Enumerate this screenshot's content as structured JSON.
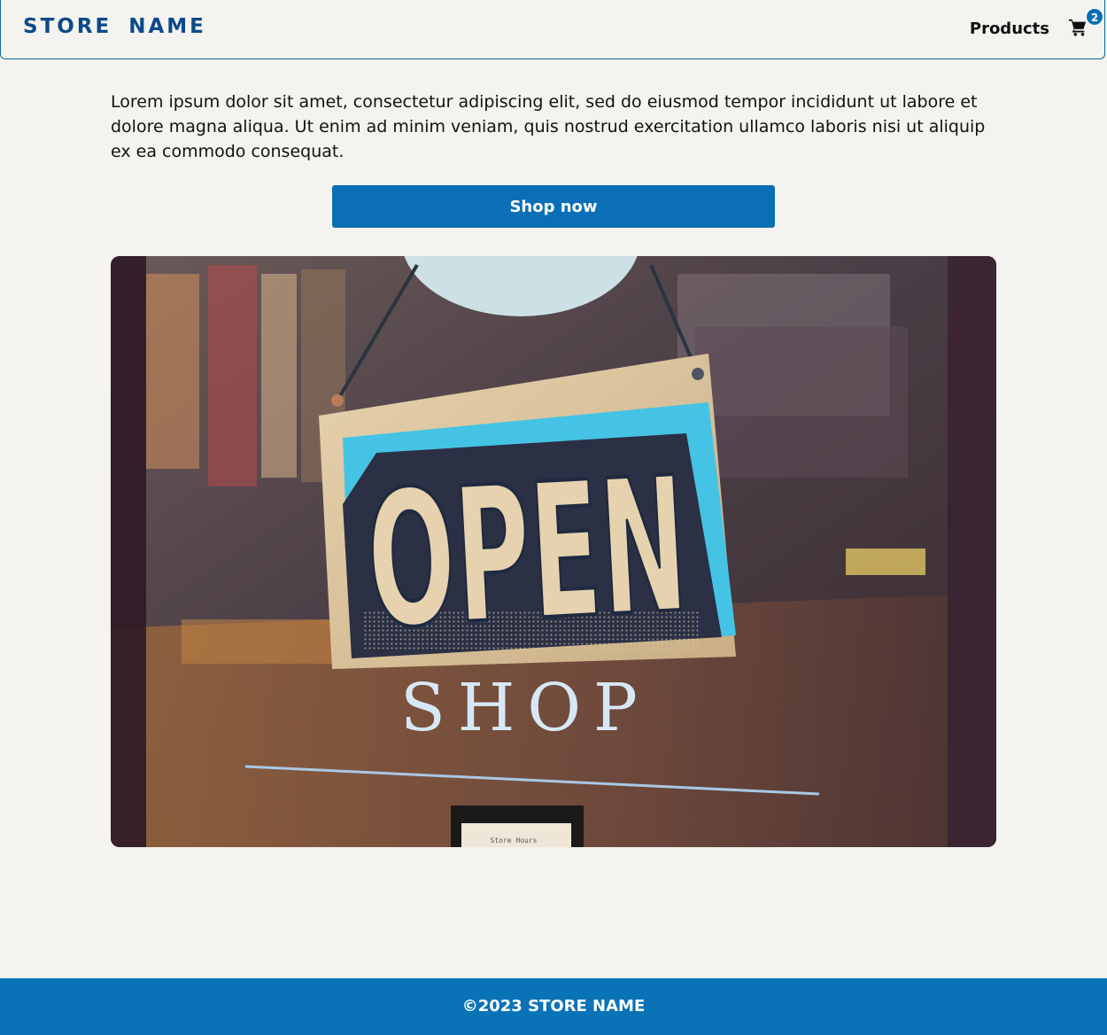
{
  "header": {
    "logo": "STORE NAME",
    "nav_products": "Products",
    "cart_count": "2"
  },
  "main": {
    "intro_text": "Lorem ipsum dolor sit amet, consectetur adipiscing elit, sed do eiusmod tempor incididunt ut labore et dolore magna aliqua. Ut enim ad minim veniam, quis nostrud exercitation ullamco laboris nisi ut aliquip ex ea commodo consequat.",
    "cta_label": "Shop now",
    "hero": {
      "sign_text": "OPEN",
      "window_text": "SHOP",
      "note_text": "Store Hours"
    }
  },
  "footer": {
    "copyright": "©2023 STORE NAME"
  },
  "colors": {
    "brand": "#0b4a8a",
    "accent": "#0a6fb5",
    "background": "#f4f3ef"
  },
  "icons": {
    "cart": "shopping-cart-icon"
  }
}
